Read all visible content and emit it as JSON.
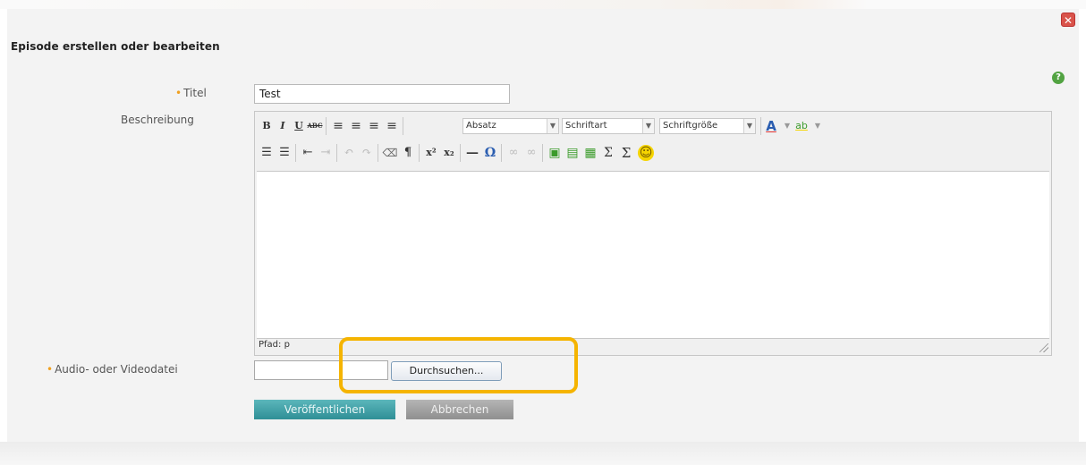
{
  "dialog": {
    "title": "Episode erstellen oder bearbeiten",
    "close_glyph": "✕",
    "help_glyph": "?"
  },
  "form": {
    "title_label": "Titel",
    "title_value": "Test",
    "description_label": "Beschreibung",
    "file_label": "Audio- oder Videodatei",
    "browse_label": "Durchsuchen...",
    "publish_label": "Veröffentlichen",
    "cancel_label": "Abbrechen",
    "required_marker": "•"
  },
  "editor": {
    "format_select": "Absatz",
    "font_select": "Schriftart",
    "size_select": "Schriftgröße",
    "path_text": "Pfad: p",
    "row1_buttons": [
      {
        "name": "bold-icon",
        "glyph": "B"
      },
      {
        "name": "italic-icon",
        "glyph": "I"
      },
      {
        "name": "underline-icon",
        "glyph": "U"
      },
      {
        "name": "strikethrough-icon",
        "glyph": "ABC"
      },
      {
        "name": "align-left-icon",
        "glyph": "≡"
      },
      {
        "name": "align-center-icon",
        "glyph": "≡"
      },
      {
        "name": "align-right-icon",
        "glyph": "≡"
      },
      {
        "name": "align-justify-icon",
        "glyph": "≡"
      }
    ],
    "row2_buttons": [
      {
        "name": "bullet-list-icon",
        "glyph": "☰"
      },
      {
        "name": "numbered-list-icon",
        "glyph": "☰"
      },
      {
        "name": "outdent-icon",
        "glyph": "⇤"
      },
      {
        "name": "indent-icon",
        "glyph": "⇥"
      },
      {
        "name": "undo-icon",
        "glyph": "↶"
      },
      {
        "name": "redo-icon",
        "glyph": "↷"
      },
      {
        "name": "clean-format-icon",
        "glyph": "⌫"
      },
      {
        "name": "paragraph-icon",
        "glyph": "¶"
      },
      {
        "name": "superscript-icon",
        "glyph": "x²"
      },
      {
        "name": "subscript-icon",
        "glyph": "x₂"
      },
      {
        "name": "horizontal-rule-icon",
        "glyph": "—"
      },
      {
        "name": "special-char-icon",
        "glyph": "Ω"
      },
      {
        "name": "link-icon",
        "glyph": "∞"
      },
      {
        "name": "unlink-icon",
        "glyph": "∞"
      },
      {
        "name": "image-icon",
        "glyph": "▣"
      },
      {
        "name": "media-icon",
        "glyph": "▤"
      },
      {
        "name": "table-icon",
        "glyph": "▦"
      },
      {
        "name": "sum-icon",
        "glyph": "Σ"
      },
      {
        "name": "sigma-icon",
        "glyph": "Σ"
      },
      {
        "name": "smiley-icon",
        "glyph": "☺"
      }
    ],
    "text_color_glyph": "A",
    "highlight_glyph": "ab"
  },
  "colors": {
    "accent": "#2f8f96",
    "highlight": "#f5b400",
    "required": "#f0a020"
  }
}
